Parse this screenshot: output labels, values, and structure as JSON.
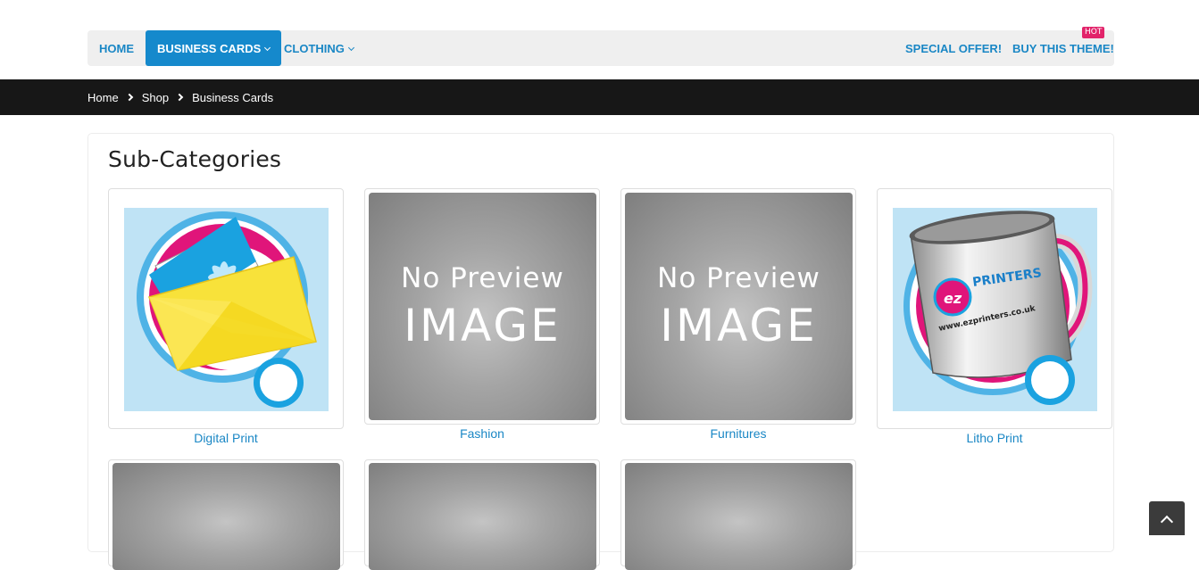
{
  "nav": {
    "left": [
      {
        "label": "HOME",
        "dropdown": false,
        "active": false
      },
      {
        "label": "BUSINESS CARDS",
        "dropdown": true,
        "active": true
      },
      {
        "label": "CLOTHING",
        "dropdown": true,
        "active": false
      }
    ],
    "right": [
      {
        "label": "SPECIAL OFFER!"
      },
      {
        "label": "BUY THIS THEME!",
        "badge": "HOT"
      }
    ],
    "accent_color": "#1589cc",
    "badge_color": "#e2236a"
  },
  "breadcrumb": [
    "Home",
    "Shop",
    "Business Cards"
  ],
  "panel": {
    "title": "Sub-Categories",
    "categories": [
      {
        "label": "Digital Print",
        "image": "envelope-business-card-image"
      },
      {
        "label": "Fashion",
        "image": "no-preview-image",
        "placeholder_line1": "No Preview",
        "placeholder_line2": "IMAGE"
      },
      {
        "label": "Furnitures",
        "image": "no-preview-image",
        "placeholder_line1": "No Preview",
        "placeholder_line2": "IMAGE"
      },
      {
        "label": "Litho Print",
        "image": "mug-ezprinters-image",
        "mug_brand": "PRINTERS",
        "mug_logo": "ez",
        "mug_url": "www.ezprinters.co.uk"
      }
    ]
  },
  "scroll_top": {
    "icon": "chevron-up-icon"
  }
}
